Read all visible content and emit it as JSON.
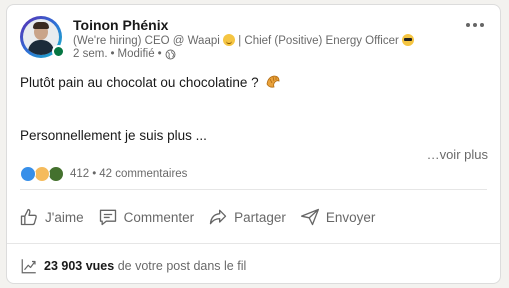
{
  "post": {
    "author_name": "Toinon Phénix",
    "author_headline": "(We're hiring) CEO @ Waapi",
    "author_headline_rest": "| Chief (Positive) Energy Officer",
    "time_ago": "2 sem.",
    "meta_separator": "•",
    "edited": "Modifié",
    "text_line1": "Plutôt pain au chocolat ou chocolatine ?",
    "text_line2": "Personnellement je suis plus ...",
    "see_more": "…voir plus",
    "reaction_count": "412",
    "comments_count": "42 commentaires",
    "visibility_icon": "globe-icon"
  },
  "actions": {
    "like": "J'aime",
    "comment": "Commenter",
    "share": "Partager",
    "send": "Envoyer"
  },
  "analytics": {
    "views_number": "23 903",
    "views_label": "vues",
    "views_suffix": "de votre post dans le fil"
  },
  "colors": {
    "like_reaction": "#378fe9",
    "insight_reaction": "#f5bb5c",
    "support_reaction": "#44712e",
    "online": "#057642"
  }
}
